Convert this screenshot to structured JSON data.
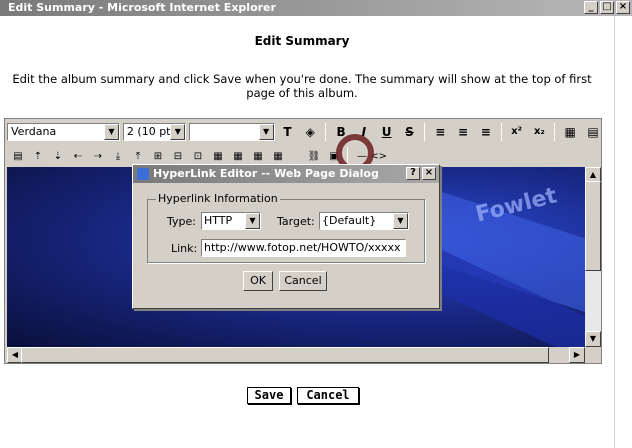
{
  "window": {
    "title": "Edit Summary - Microsoft Internet Explorer"
  },
  "page": {
    "title": "Edit Summary",
    "description_line1": "Edit the album summary and click Save when you're done. The summary will show at the top of first",
    "description_line2": "page of this album."
  },
  "editor": {
    "font": "Verdana",
    "size": "2 (10 pt)",
    "style": "",
    "format_buttons": [
      "B",
      "I",
      "U",
      "S"
    ],
    "sup": "x²",
    "sub": "x₂",
    "misc_right": "— <>",
    "image_text": "Fowlet"
  },
  "dialog": {
    "title": "HyperLink Editor -- Web Page Dialog",
    "group_label": "Hyperlink Information",
    "type_label": "Type:",
    "type_value": "HTTP",
    "target_label": "Target:",
    "target_value": "{Default}",
    "link_label": "Link:",
    "link_value": "http://www.fotop.net/HOWTO/xxxxx",
    "ok": "OK",
    "cancel": "Cancel"
  },
  "actions": {
    "save": "Save",
    "cancel": "Cancel"
  }
}
